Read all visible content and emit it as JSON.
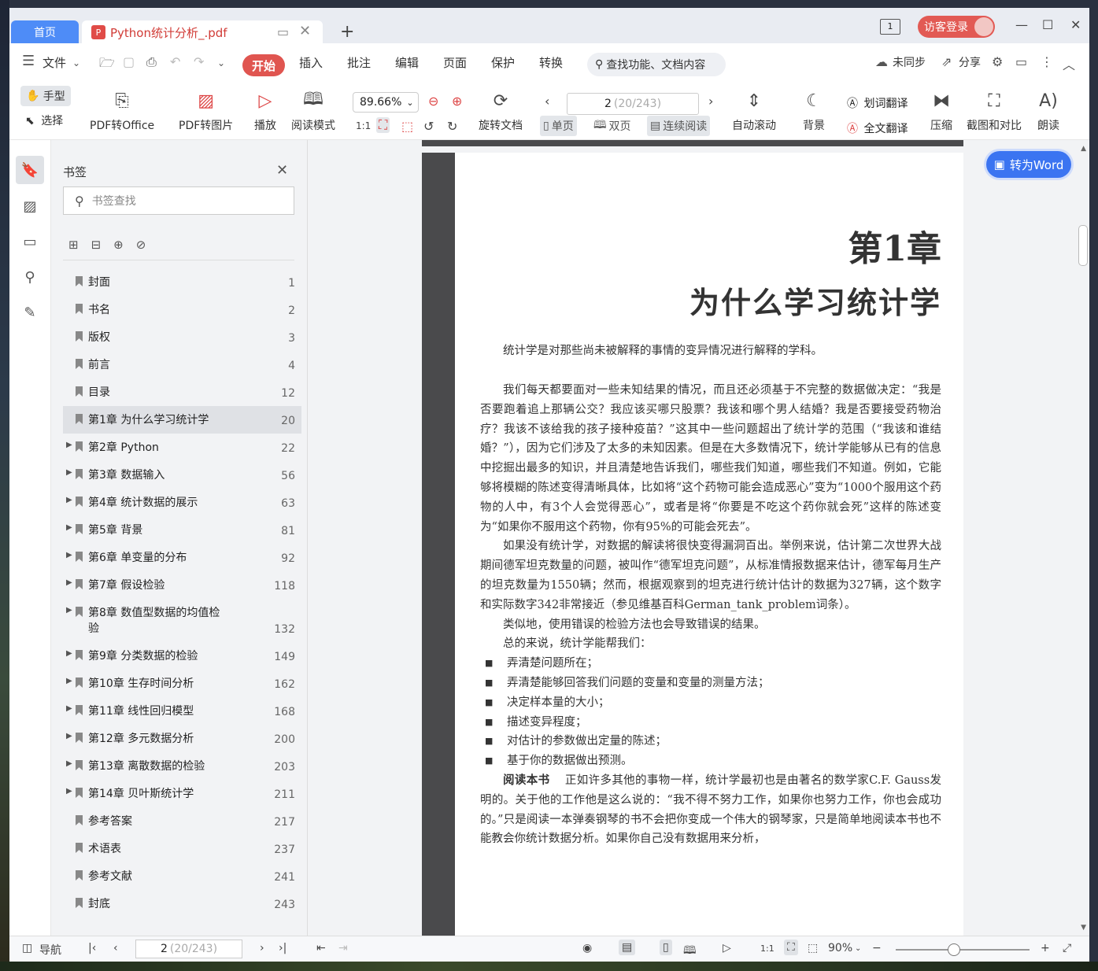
{
  "window": {
    "home_tab": "首页",
    "doc_tab": "Python统计分析_.pdf",
    "login": "访客登录"
  },
  "menu": {
    "file": "文件",
    "items": [
      "开始",
      "插入",
      "批注",
      "编辑",
      "页面",
      "保护",
      "转换"
    ],
    "search_placeholder": "查找功能、文档内容",
    "sync": "未同步",
    "share": "分享"
  },
  "toolbar": {
    "hand": "手型",
    "select": "选择",
    "pdf_to_office": "PDF转Office",
    "pdf_to_image": "PDF转图片",
    "play": "播放",
    "read_mode": "阅读模式",
    "zoom": "89.66%",
    "rotate": "旋转文档",
    "page_current": "2",
    "page_total": "(20/243)",
    "single": "单页",
    "double": "双页",
    "continuous": "连续阅读",
    "auto_scroll": "自动滚动",
    "background": "背景",
    "word_translate": "划词翻译",
    "full_translate": "全文翻译",
    "compress": "压缩",
    "screenshot": "截图和对比",
    "read_aloud": "朗读"
  },
  "bookmarks": {
    "title": "书签",
    "search_placeholder": "书签查找",
    "items": [
      {
        "label": "封面",
        "page": "1",
        "expandable": false
      },
      {
        "label": "书名",
        "page": "2",
        "expandable": false
      },
      {
        "label": "版权",
        "page": "3",
        "expandable": false
      },
      {
        "label": "前言",
        "page": "4",
        "expandable": false
      },
      {
        "label": "目录",
        "page": "12",
        "expandable": false
      },
      {
        "label": "第1章 为什么学习统计学",
        "page": "20",
        "expandable": false,
        "selected": true
      },
      {
        "label": "第2章 Python",
        "page": "22",
        "expandable": true
      },
      {
        "label": "第3章 数据输入",
        "page": "56",
        "expandable": true
      },
      {
        "label": "第4章 统计数据的展示",
        "page": "63",
        "expandable": true
      },
      {
        "label": "第5章 背景",
        "page": "81",
        "expandable": true
      },
      {
        "label": "第6章 单变量的分布",
        "page": "92",
        "expandable": true
      },
      {
        "label": "第7章 假设检验",
        "page": "118",
        "expandable": true
      },
      {
        "label": "第8章 数值型数据的均值检验",
        "page": "132",
        "expandable": true
      },
      {
        "label": "第9章 分类数据的检验",
        "page": "149",
        "expandable": true
      },
      {
        "label": "第10章 生存时间分析",
        "page": "162",
        "expandable": true
      },
      {
        "label": "第11章 线性回归模型",
        "page": "168",
        "expandable": true
      },
      {
        "label": "第12章 多元数据分析",
        "page": "200",
        "expandable": true
      },
      {
        "label": "第13章 离散数据的检验",
        "page": "203",
        "expandable": true
      },
      {
        "label": "第14章 贝叶斯统计学",
        "page": "211",
        "expandable": true
      },
      {
        "label": "参考答案",
        "page": "217",
        "expandable": false
      },
      {
        "label": "术语表",
        "page": "237",
        "expandable": false
      },
      {
        "label": "参考文献",
        "page": "241",
        "expandable": false
      },
      {
        "label": "封底",
        "page": "243",
        "expandable": false
      }
    ]
  },
  "doc": {
    "to_word": "转为Word",
    "chapter_number": "第1章",
    "chapter_title": "为什么学习统计学",
    "epigraph": "统计学是对那些尚未被解释的事情的变异情况进行解释的学科。",
    "para1": "我们每天都要面对一些未知结果的情况，而且还必须基于不完整的数据做决定：“我是否要跑着追上那辆公交？我应该买哪只股票？我该和哪个男人结婚？我是否要接受药物治疗？我该不该给我的孩子接种疫苗？”这其中一些问题超出了统计学的范围（“我该和谁结婚？”），因为它们涉及了太多的未知因素。但是在大多数情况下，统计学能够从已有的信息中挖掘出最多的知识，并且清楚地告诉我们，哪些我们知道，哪些我们不知道。例如，它能够将模糊的陈述变得清晰具体，比如将“这个药物可能会造成恶心”变为“1000个服用这个药物的人中，有3个人会觉得恶心”，或者是将“你要是不吃这个药你就会死”这样的陈述变为“如果你不服用这个药物，你有95%的可能会死去”。",
    "para2": "如果没有统计学，对数据的解读将很快变得漏洞百出。举例来说，估计第二次世界大战期间德军坦克数量的问题，被叫作“德军坦克问题”，从标准情报数据来估计，德军每月生产的坦克数量为1550辆；然而，根据观察到的坦克进行统计估计的数据为327辆，这个数字和实际数字342非常接近（参见维基百科German_tank_problem词条）。",
    "para3": "类似地，使用错误的检验方法也会导致错误的结果。",
    "para4": "总的来说，统计学能帮我们：",
    "bullets": [
      "弄清楚问题所在；",
      "弄清楚能够回答我们问题的变量和变量的测量方法；",
      "决定样本量的大小；",
      "描述变异程度；",
      "对估计的参数做出定量的陈述；",
      "基于你的数据做出预测。"
    ],
    "reading_head": "阅读本书",
    "reading_text": "正如许多其他的事物一样，统计学最初也是由著名的数学家C.F. Gauss发明的。关于他的工作他是这么说的：“我不得不努力工作，如果你也努力工作，你也会成功的。”只是阅读一本弹奏钢琴的书不会把你变成一个伟大的钢琴家，只是简单地阅读本书也不能教会你统计数据分析。如果你自己没有数据用来分析，"
  },
  "status": {
    "nav": "导航",
    "page_current": "2",
    "page_total": "(20/243)",
    "zoom": "90%"
  }
}
